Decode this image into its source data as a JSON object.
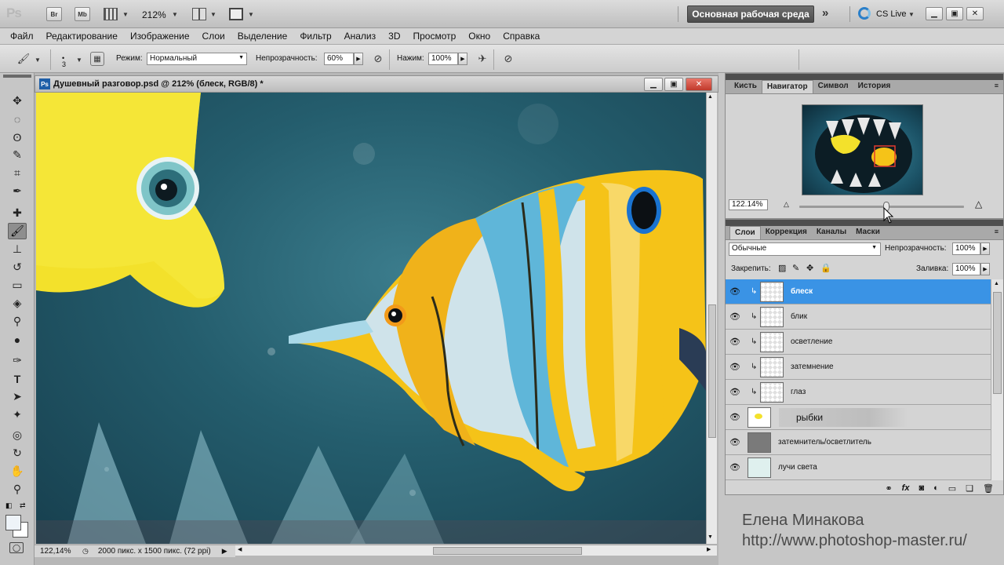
{
  "app": {
    "logo": "Ps",
    "bridge_label": "Br",
    "minibridge_label": "Mb",
    "zoom": "212%",
    "workspace": "Основная рабочая среда",
    "cs_live": "CS Live"
  },
  "menu": [
    "Файл",
    "Редактирование",
    "Изображение",
    "Слои",
    "Выделение",
    "Фильтр",
    "Анализ",
    "3D",
    "Просмотр",
    "Окно",
    "Справка"
  ],
  "options": {
    "brush_size": "3",
    "mode_label": "Режим:",
    "mode_value": "Нормальный",
    "opacity_label": "Непрозрачность:",
    "opacity_value": "60%",
    "flow_label": "Нажим:",
    "flow_value": "100%"
  },
  "document": {
    "title": "Душевный разговор.psd @ 212% (блеск, RGB/8) *",
    "badge": "Ps",
    "zoom": "122,14%",
    "dimensions": "2000 пикс. x 1500 пикс. (72 ppi)"
  },
  "navigator": {
    "tabs": [
      "Кисть",
      "Навигатор",
      "Символ",
      "История"
    ],
    "active_tab": 1,
    "zoom": "122.14%",
    "zoom_slider": 0.53
  },
  "layers": {
    "tabs": [
      "Слои",
      "Коррекция",
      "Каналы",
      "Маски"
    ],
    "blend_mode": "Обычные",
    "opacity_label": "Непрозрачность:",
    "opacity_value": "100%",
    "lock_label": "Закрепить:",
    "fill_label": "Заливка:",
    "fill_value": "100%",
    "items": [
      {
        "name": "блеск",
        "selected": true,
        "clipped": true
      },
      {
        "name": "блик",
        "selected": false,
        "clipped": true
      },
      {
        "name": "осветление",
        "selected": false,
        "clipped": true
      },
      {
        "name": "затемнение",
        "selected": false,
        "clipped": true
      },
      {
        "name": "глаз",
        "selected": false,
        "clipped": true
      },
      {
        "name": "рыбки",
        "selected": false,
        "clipped": false
      },
      {
        "name": "затемнитель/осветлитель",
        "selected": false,
        "clipped": false
      },
      {
        "name": "лучи света",
        "selected": false,
        "clipped": false
      }
    ]
  },
  "watermark": {
    "author": "Елена Минакова",
    "url": "http://www.photoshop-master.ru/"
  }
}
